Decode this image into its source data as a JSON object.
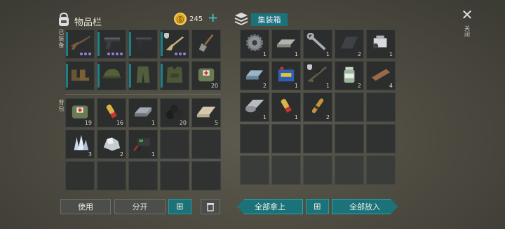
{
  "inventory": {
    "title": "物品栏",
    "currency": "245",
    "add_label": "+",
    "equipped_label": "已装备",
    "backpack_label": "背包",
    "equipped_slots": [
      {
        "name": "shotgun-slot",
        "icon": "shotgun-icon",
        "count": "",
        "dots": 3,
        "accent": true
      },
      {
        "name": "pistol-slot",
        "icon": "pistol-icon",
        "count": "",
        "dots": 4,
        "accent": true
      },
      {
        "name": "pistol-2-slot",
        "icon": "pistol-icon",
        "count": "",
        "dots": 0,
        "accent": true
      },
      {
        "name": "rifle-slot",
        "icon": "rifle-icon",
        "count": "",
        "dots": 3,
        "accent": true,
        "shield": true
      },
      {
        "name": "shovel-slot",
        "icon": "shovel-icon",
        "count": "",
        "dots": 0,
        "accent": false
      },
      {
        "name": "boots-slot",
        "icon": "boots-icon",
        "count": "",
        "dots": 0,
        "accent": true
      },
      {
        "name": "cap-slot",
        "icon": "cap-icon",
        "count": "",
        "dots": 0,
        "accent": true
      },
      {
        "name": "pants-slot",
        "icon": "pants-icon",
        "count": "",
        "dots": 0,
        "accent": true
      },
      {
        "name": "vest-slot",
        "icon": "vest-icon",
        "count": "",
        "dots": 0,
        "accent": true
      },
      {
        "name": "medkit-bag-slot",
        "icon": "medkit-icon",
        "count": "20",
        "dots": 0,
        "accent": false
      }
    ],
    "backpack_slots": [
      {
        "name": "medkit-bag-slot",
        "icon": "medkit-icon",
        "count": "19"
      },
      {
        "name": "shell-slot",
        "icon": "shell-icon",
        "count": "16"
      },
      {
        "name": "iron-bar-slot",
        "icon": "iron-bar-icon",
        "count": "1"
      },
      {
        "name": "coal-slot",
        "icon": "coal-icon",
        "count": "20"
      },
      {
        "name": "cloth-slot",
        "icon": "cloth-icon",
        "count": "5"
      },
      {
        "name": "crystal-slot",
        "icon": "crystal-icon",
        "count": "3"
      },
      {
        "name": "ore-slot",
        "icon": "ore-icon",
        "count": "2"
      },
      {
        "name": "battery-slot",
        "icon": "battery-icon",
        "count": "1"
      },
      {
        "name": "empty",
        "icon": "",
        "count": ""
      },
      {
        "name": "empty",
        "icon": "",
        "count": ""
      },
      {
        "name": "empty",
        "icon": "",
        "count": ""
      },
      {
        "name": "empty",
        "icon": "",
        "count": ""
      },
      {
        "name": "empty",
        "icon": "",
        "count": ""
      },
      {
        "name": "empty",
        "icon": "",
        "count": ""
      },
      {
        "name": "empty",
        "icon": "",
        "count": ""
      }
    ],
    "use_button": "使用",
    "split_button": "分开"
  },
  "container": {
    "title": "集装箱",
    "close_label": "关闭",
    "slots": [
      {
        "name": "gear-slot",
        "icon": "gear-icon",
        "count": "1"
      },
      {
        "name": "metal-bar-slot",
        "icon": "metal-bar-icon",
        "count": "1"
      },
      {
        "name": "wrench-slot",
        "icon": "wrench-icon",
        "count": "1"
      },
      {
        "name": "plate-slot",
        "icon": "plate-icon",
        "count": "2"
      },
      {
        "name": "engine-slot",
        "icon": "engine-icon",
        "count": "1"
      },
      {
        "name": "ingot-slot",
        "icon": "ingot-icon",
        "count": "2"
      },
      {
        "name": "car-battery-slot",
        "icon": "car-battery-icon",
        "count": "1"
      },
      {
        "name": "sniper-slot",
        "icon": "sniper-icon",
        "count": "1",
        "shield": true
      },
      {
        "name": "pills-slot",
        "icon": "pills-icon",
        "count": "2"
      },
      {
        "name": "plank-slot",
        "icon": "plank-icon",
        "count": "4"
      },
      {
        "name": "sheet-metal-slot",
        "icon": "sheet-metal-icon",
        "count": "1"
      },
      {
        "name": "shell-slot",
        "icon": "shell-icon",
        "count": "1"
      },
      {
        "name": "ammo-slot",
        "icon": "ammo-icon",
        "count": "2"
      }
    ],
    "take_all": "全部拿上",
    "put_all": "全部放入"
  },
  "colors": {
    "accent": "#1b7278",
    "slot": "#2b2e2d",
    "coin": "#e0a826",
    "dots": "#9a7ad8"
  }
}
